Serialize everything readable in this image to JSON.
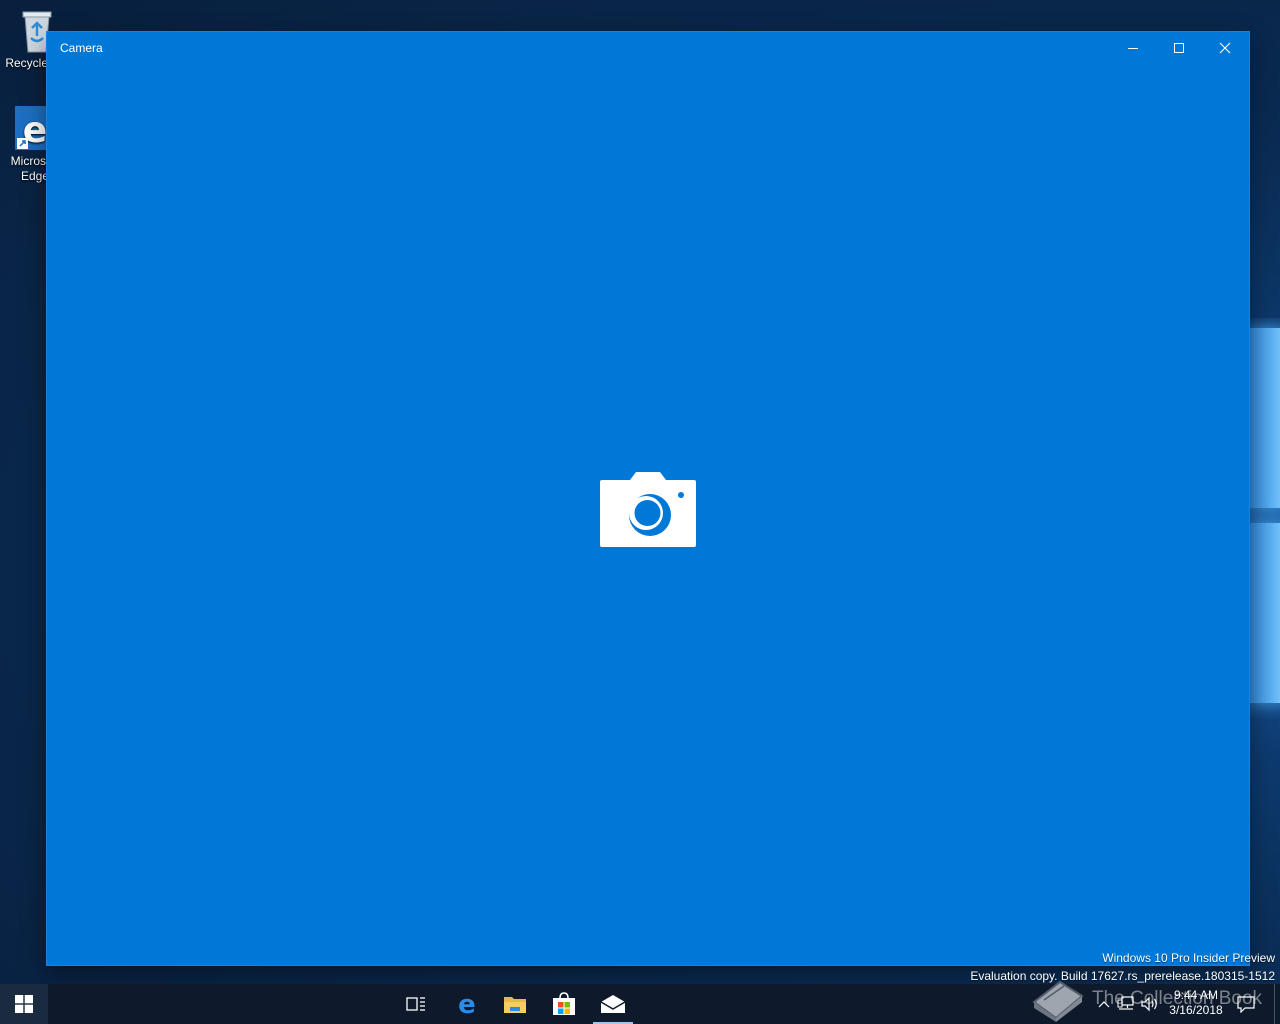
{
  "desktop": {
    "icons": [
      {
        "label": "Recycle Bin",
        "icon": "recycle-bin-icon"
      },
      {
        "label": "Microsoft Edge",
        "icon": "edge-icon"
      }
    ]
  },
  "window": {
    "title": "Camera",
    "center_icon": "camera-icon",
    "background": "#0078d7"
  },
  "watermark": {
    "edition": "Windows 10 Pro Insider Preview",
    "build": "Evaluation copy. Build 17627.rs_prerelease.180315-1512"
  },
  "taskbar": {
    "apps": [
      {
        "name": "Task View",
        "icon": "task-view-icon"
      },
      {
        "name": "Microsoft Edge",
        "icon": "edge-icon"
      },
      {
        "name": "File Explorer",
        "icon": "folder-icon"
      },
      {
        "name": "Microsoft Store",
        "icon": "store-icon"
      },
      {
        "name": "Mail",
        "icon": "mail-icon"
      }
    ],
    "clock": {
      "time": "9:44 AM",
      "date": "3/16/2018"
    }
  },
  "overlay": {
    "brand": "The Collection Book"
  }
}
